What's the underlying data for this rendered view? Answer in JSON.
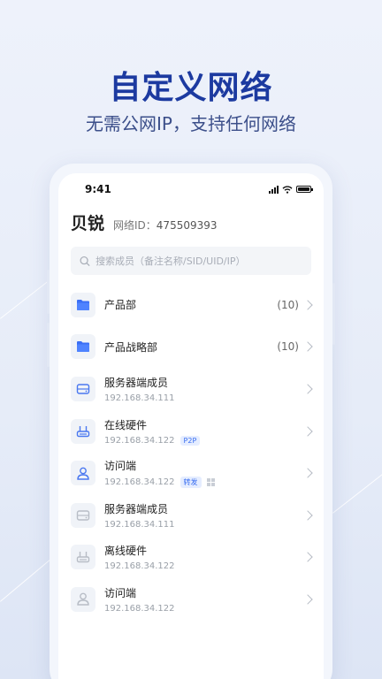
{
  "hero": {
    "title": "自定义网络",
    "subtitle": "无需公网IP，支持任何网络"
  },
  "status_bar": {
    "time": "9:41"
  },
  "team": {
    "name": "贝锐",
    "network_label": "网络ID：",
    "network_id": "475509393"
  },
  "search": {
    "placeholder": "搜索成员（备注名称/SID/UID/IP）"
  },
  "items": [
    {
      "title": "产品部",
      "count": "(10)"
    },
    {
      "title": "产品战略部",
      "count": "(10)"
    },
    {
      "title": "服务器端成员",
      "ip": "192.168.34.111"
    },
    {
      "title": "在线硬件",
      "ip": "192.168.34.122",
      "tag": "P2P"
    },
    {
      "title": "访问端",
      "ip": "192.168.34.122",
      "tag": "转发"
    },
    {
      "title": "服务器端成员",
      "ip": "192.168.34.111"
    },
    {
      "title": "离线硬件",
      "ip": "192.168.34.122"
    },
    {
      "title": "访问端",
      "ip": "192.168.34.122"
    }
  ],
  "colors": {
    "brand": "#1c3aa0",
    "folder": "#3b6ff5",
    "online_icon": "#4a78f0",
    "offline_icon": "#b8bdc6"
  }
}
